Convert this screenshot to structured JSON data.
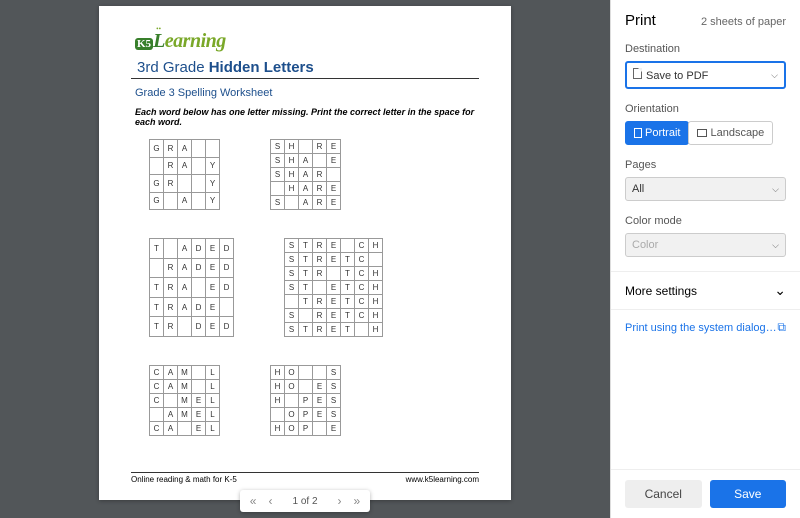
{
  "preview": {
    "logo_text": "earning",
    "title_prefix": "3rd Grade ",
    "title_bold": "Hidden Letters",
    "subtitle": "Grade 3 Spelling Worksheet",
    "instructions": "Each word below has one letter missing. Print the correct letter in the space for each word.",
    "grids": [
      [
        [
          [
            "G",
            "R",
            "A",
            "",
            ""
          ],
          [
            "",
            "R",
            "A",
            "",
            "Y"
          ],
          [
            "G",
            "R",
            "",
            "",
            "Y"
          ],
          [
            "G",
            "",
            "A",
            "",
            "Y"
          ]
        ],
        [
          [
            "S",
            "H",
            "",
            "R",
            "E"
          ],
          [
            "S",
            "H",
            "A",
            "",
            "E"
          ],
          [
            "S",
            "H",
            "A",
            "R",
            ""
          ],
          [
            "",
            "H",
            "A",
            "R",
            "E"
          ],
          [
            "S",
            "",
            "A",
            "R",
            "E"
          ]
        ]
      ],
      [
        [
          [
            "T",
            "",
            "A",
            "D",
            "E",
            "D"
          ],
          [
            "",
            "R",
            "A",
            "D",
            "E",
            "D"
          ],
          [
            "T",
            "R",
            "A",
            "",
            "E",
            "D"
          ],
          [
            "T",
            "R",
            "A",
            "D",
            "E",
            ""
          ],
          [
            "T",
            "R",
            "",
            "D",
            "E",
            "D"
          ]
        ],
        [
          [
            "S",
            "T",
            "R",
            "E",
            "",
            "C",
            "H"
          ],
          [
            "S",
            "T",
            "R",
            "E",
            "T",
            "C",
            ""
          ],
          [
            "S",
            "T",
            "R",
            "",
            "T",
            "C",
            "H"
          ],
          [
            "S",
            "T",
            "",
            "E",
            "T",
            "C",
            "H"
          ],
          [
            "",
            "T",
            "R",
            "E",
            "T",
            "C",
            "H"
          ],
          [
            "S",
            "",
            "R",
            "E",
            "T",
            "C",
            "H"
          ],
          [
            "S",
            "T",
            "R",
            "E",
            "T",
            "",
            "H"
          ]
        ]
      ],
      [
        [
          [
            "C",
            "A",
            "M",
            "",
            "L"
          ],
          [
            "C",
            "A",
            "M",
            "",
            "L"
          ],
          [
            "C",
            "",
            "M",
            "E",
            "L"
          ],
          [
            "",
            "A",
            "M",
            "E",
            "L"
          ],
          [
            "C",
            "A",
            "",
            "E",
            "L"
          ]
        ],
        [
          [
            "H",
            "O",
            "",
            "",
            "S"
          ],
          [
            "H",
            "O",
            "",
            "E",
            "S"
          ],
          [
            "H",
            "",
            "P",
            "E",
            "S"
          ],
          [
            "",
            "O",
            "P",
            "E",
            "S"
          ],
          [
            "H",
            "O",
            "P",
            "",
            "E"
          ]
        ]
      ]
    ],
    "footer_left": "Online reading & math for K-5",
    "footer_right": "www.k5learning.com",
    "nav_page": "1 of 2"
  },
  "panel": {
    "title": "Print",
    "sheets": "2 sheets of paper",
    "destination_label": "Destination",
    "destination_value": "Save to PDF",
    "orientation_label": "Orientation",
    "orientation_portrait": "Portrait",
    "orientation_landscape": "Landscape",
    "pages_label": "Pages",
    "pages_value": "All",
    "color_label": "Color mode",
    "color_value": "Color",
    "more_settings": "More settings",
    "system_dialog": "Print using the system dialog…",
    "cancel": "Cancel",
    "save": "Save"
  }
}
